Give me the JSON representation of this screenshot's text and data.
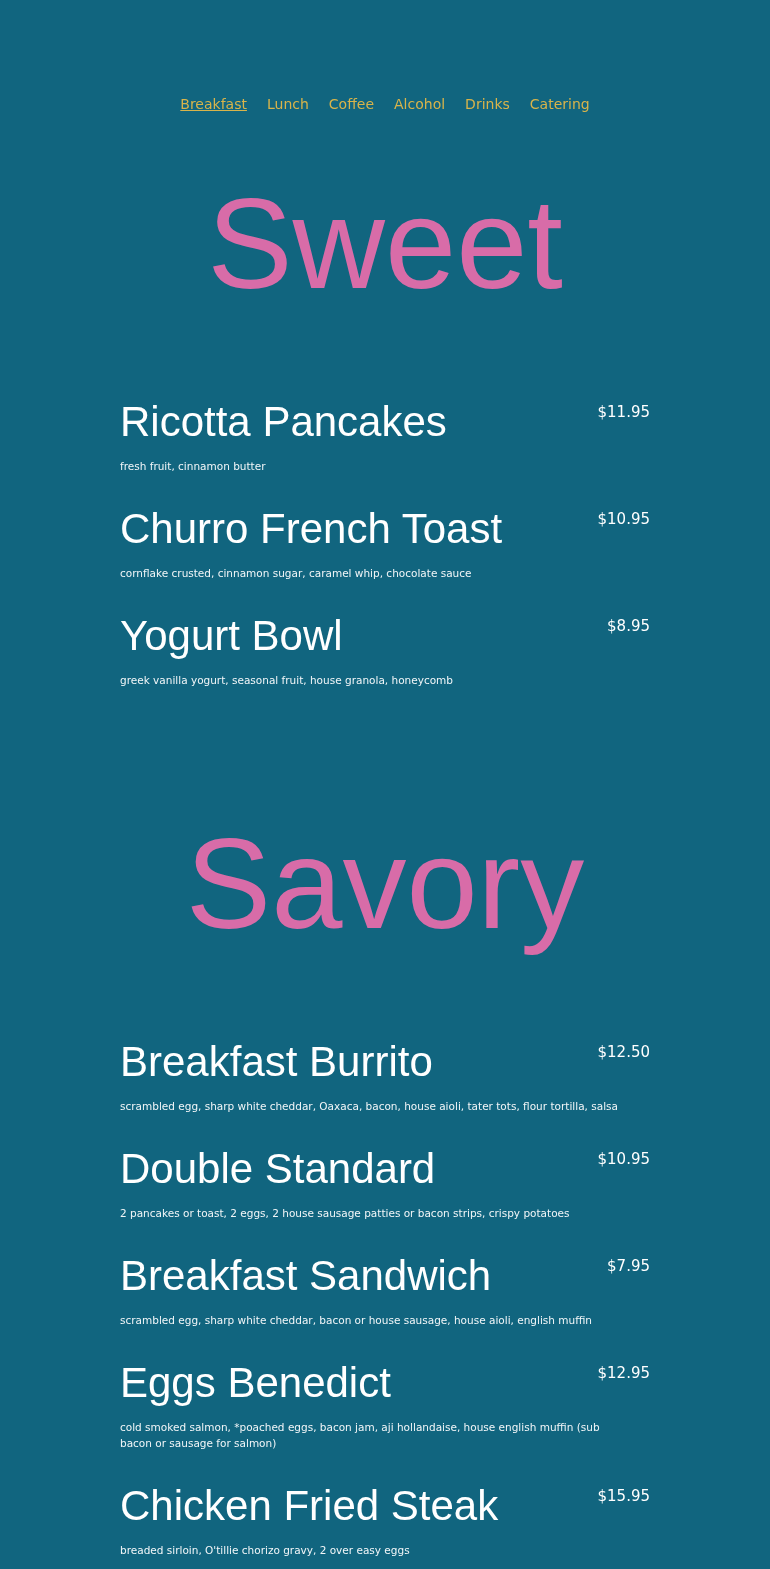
{
  "nav": [
    {
      "label": "Breakfast",
      "selected": true
    },
    {
      "label": "Lunch",
      "selected": false
    },
    {
      "label": "Coffee",
      "selected": false
    },
    {
      "label": "Alcohol",
      "selected": false
    },
    {
      "label": "Drinks",
      "selected": false
    },
    {
      "label": "Catering",
      "selected": false
    }
  ],
  "sections": [
    {
      "title": "Sweet",
      "items": [
        {
          "name": "Ricotta Pancakes",
          "price": "$11.95",
          "description": "fresh fruit, cinnamon butter"
        },
        {
          "name": "Churro French Toast",
          "price": "$10.95",
          "description": "cornflake crusted, cinnamon sugar, caramel whip, chocolate sauce"
        },
        {
          "name": "Yogurt Bowl",
          "price": "$8.95",
          "description": "greek vanilla yogurt, seasonal fruit, house granola, honeycomb"
        }
      ]
    },
    {
      "title": "Savory",
      "items": [
        {
          "name": "Breakfast Burrito",
          "price": "$12.50",
          "description": "scrambled egg, sharp white cheddar, Oaxaca, bacon, house aioli, tater tots, flour tortilla, salsa"
        },
        {
          "name": "Double Standard",
          "price": "$10.95",
          "description": "2 pancakes or toast, 2 eggs, 2 house sausage patties or bacon strips, crispy potatoes"
        },
        {
          "name": "Breakfast Sandwich",
          "price": "$7.95",
          "description": "scrambled egg, sharp white cheddar, bacon or house sausage, house aioli, english muffin"
        },
        {
          "name": "Eggs Benedict",
          "price": "$12.95",
          "description": "cold smoked salmon, *poached eggs, bacon jam, aji hollandaise, house english muffin (sub bacon or sausage for salmon)"
        },
        {
          "name": "Chicken Fried Steak",
          "price": "$15.95",
          "description": "breaded sirloin, O'tillie chorizo gravy, 2 over easy eggs"
        }
      ]
    }
  ]
}
